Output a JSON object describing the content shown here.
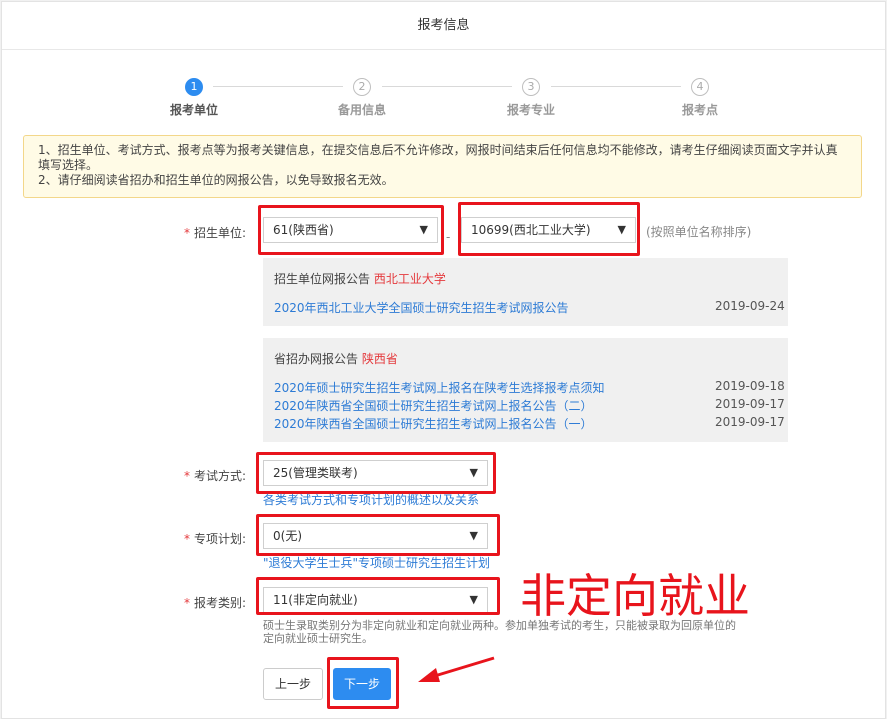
{
  "header": {
    "title": "报考信息"
  },
  "steps": [
    {
      "num": "1",
      "label": "报考单位",
      "active": true
    },
    {
      "num": "2",
      "label": "备用信息",
      "active": false
    },
    {
      "num": "3",
      "label": "报考专业",
      "active": false
    },
    {
      "num": "4",
      "label": "报考点",
      "active": false
    }
  ],
  "notice": {
    "line1": "1、招生单位、考试方式、报考点等为报考关键信息，在提交信息后不允许修改，网报时间结束后任何信息均不能修改，请考生仔细阅读页面文字并认真",
    "line2": "填写选择。",
    "line3": "2、请仔细阅读省招办和招生单位的网报公告，以免导致报名无效。"
  },
  "unit": {
    "label": "招生单位:",
    "province_value": "61(陕西省)",
    "school_value": "10699(西北工业大学)",
    "dash": "-",
    "hint": "(按照单位名称排序)"
  },
  "school_announcements": {
    "title": "招生单位网报公告",
    "highlight": "西北工业大学",
    "items": [
      {
        "text": "2020年西北工业大学全国硕士研究生招生考试网报公告",
        "date": "2019-09-24"
      }
    ]
  },
  "province_announcements": {
    "title": "省招办网报公告",
    "highlight": "陕西省",
    "items": [
      {
        "text": "2020年硕士研究生招生考试网上报名在陕考生选择报考点须知",
        "date": "2019-09-18"
      },
      {
        "text": "2020年陕西省全国硕士研究生招生考试网上报名公告（二）",
        "date": "2019-09-17"
      },
      {
        "text": "2020年陕西省全国硕士研究生招生考试网上报名公告（一）",
        "date": "2019-09-17"
      }
    ]
  },
  "exam_method": {
    "label": "考试方式:",
    "value": "25(管理类联考)",
    "link": "各类考试方式和专项计划的概述以及关系"
  },
  "special_plan": {
    "label": "专项计划:",
    "value": "0(无)",
    "link": "\"退役大学生士兵\"专项硕士研究生招生计划"
  },
  "category": {
    "label": "报考类别:",
    "value": "11(非定向就业)",
    "desc_line1": "硕士生录取类别分为非定向就业和定向就业两种。参加单独考试的考生，只能被录取为回原单位的",
    "desc_line2": "定向就业硕士研究生。"
  },
  "buttons": {
    "prev": "上一步",
    "next": "下一步"
  },
  "annotation": {
    "text": "非定向就业"
  },
  "colors": {
    "accent": "#2d8cf0",
    "highlight_red": "#e8141c",
    "link": "#2d7bd5"
  }
}
